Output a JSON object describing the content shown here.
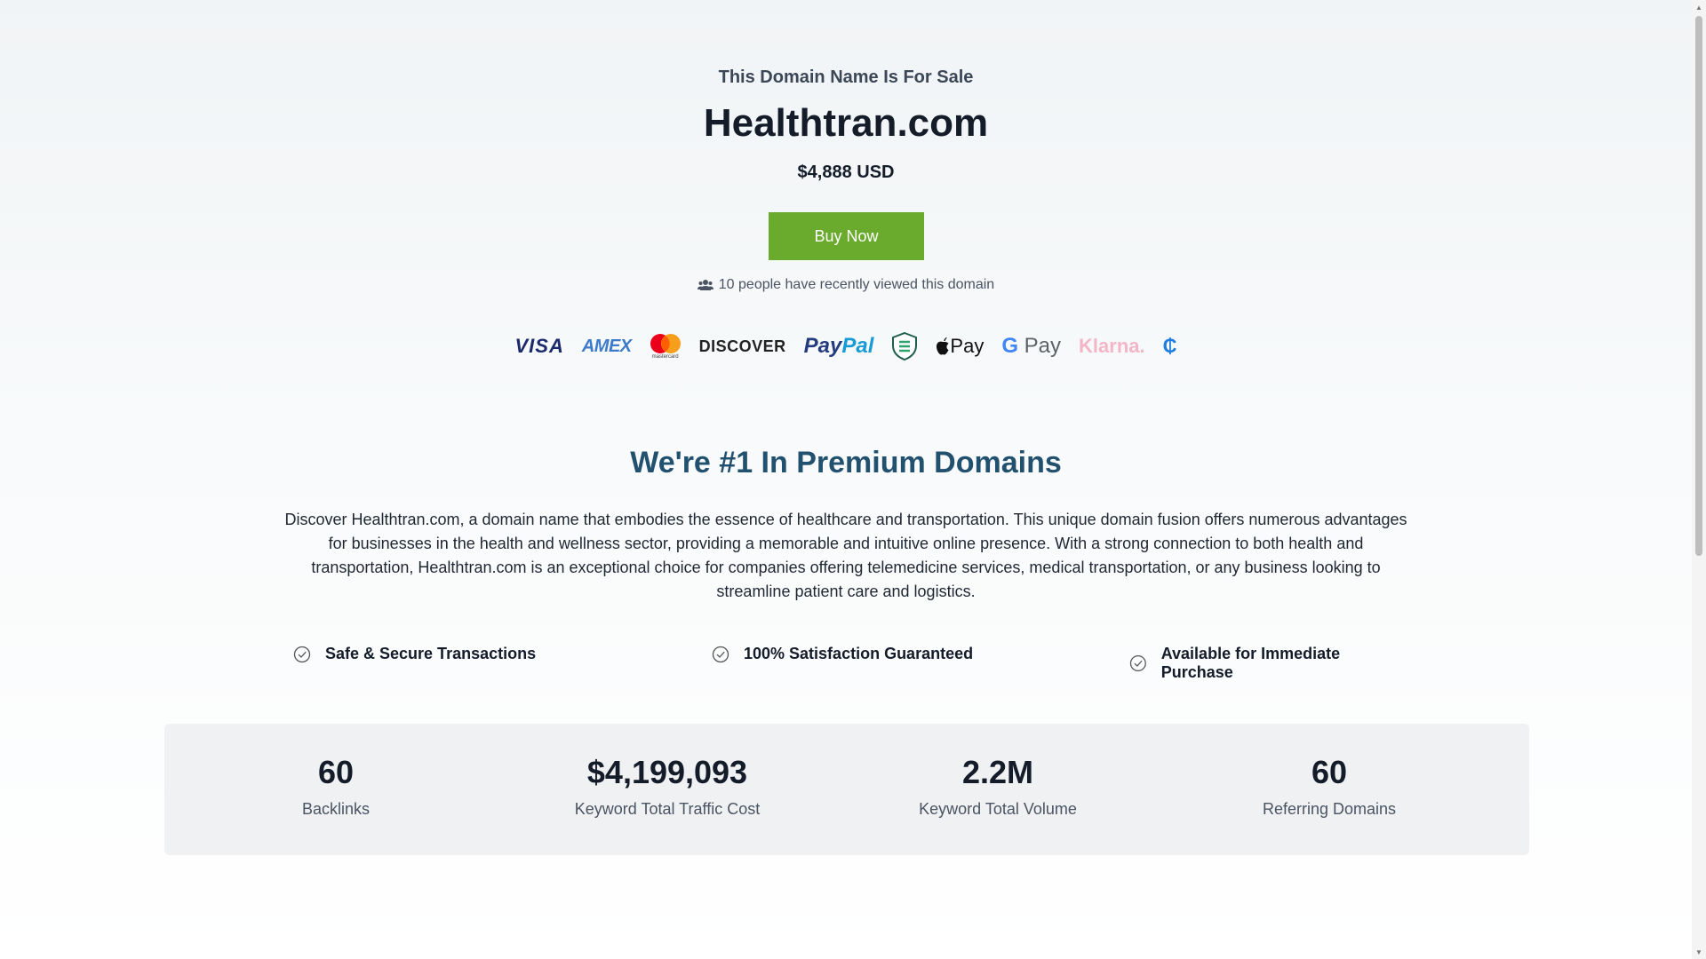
{
  "hero": {
    "subtitle": "This Domain Name Is For Sale",
    "domain": "Healthtran.com",
    "price": "$4,888 USD",
    "buy_label": "Buy Now",
    "viewers_text": "10 people have recently viewed this domain"
  },
  "payments": {
    "visa": "VISA",
    "amex": "AMEX",
    "mastercard": "mastercard",
    "discover": "DISCOVER",
    "paypal_a": "Pay",
    "paypal_b": "Pal",
    "applepay": "Pay",
    "gpay_g": "G",
    "gpay_text": "Pay",
    "klarna": "Klarna.",
    "coin": "₵"
  },
  "about": {
    "title": "We're #1 In Premium Domains",
    "description": "Discover Healthtran.com, a domain name that embodies the essence of healthcare and transportation. This unique domain fusion offers numerous advantages for businesses in the health and wellness sector, providing a memorable and intuitive online presence. With a strong connection to both health and transportation, Healthtran.com is an exceptional choice for companies offering telemedicine services, medical transportation, or any business looking to streamline patient care and logistics."
  },
  "features": [
    {
      "label": "Safe & Secure Transactions",
      "icon": "check-circle-icon"
    },
    {
      "label": "100% Satisfaction Guaranteed",
      "icon": "check-circle-icon"
    },
    {
      "label": "Available for Immediate Purchase",
      "icon": "check-circle-icon"
    }
  ],
  "stats": [
    {
      "value": "60",
      "label": "Backlinks"
    },
    {
      "value": "$4,199,093",
      "label": "Keyword Total Traffic Cost"
    },
    {
      "value": "2.2M",
      "label": "Keyword Total Volume"
    },
    {
      "value": "60",
      "label": "Referring Domains"
    }
  ],
  "colors": {
    "buy_button": "#6aab2e",
    "section_title": "#22506f",
    "text_dark": "#141c2a"
  }
}
